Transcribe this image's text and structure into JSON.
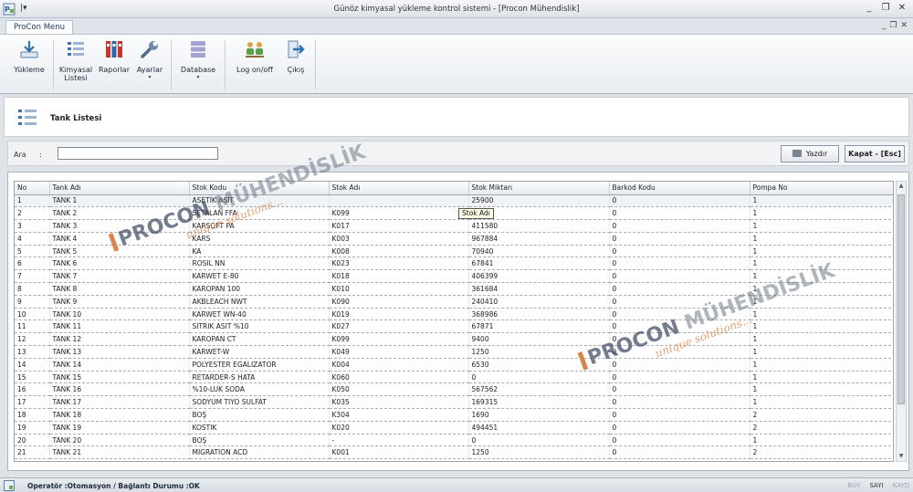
{
  "window": {
    "title": "Günöz kimyasal yükleme kontrol sistemi - [Procon Mühendislik]",
    "quick_access": "|▾",
    "controls": {
      "minimize": "_",
      "restore": "❐",
      "close": "✕"
    },
    "mdi_controls": {
      "minimize": "_",
      "restore": "❐",
      "close": "✕"
    }
  },
  "ribbon": {
    "tab": "ProCon Menu",
    "buttons": [
      {
        "label": "Yükleme",
        "icon": "download-icon"
      },
      {
        "label": "Kimyasal\nListesi",
        "icon": "list-icon"
      },
      {
        "label": "Raporlar",
        "icon": "reports-icon"
      },
      {
        "label": "Ayarlar",
        "icon": "wrench-icon",
        "dropdown": "▾"
      },
      {
        "label": "Database",
        "icon": "database-icon",
        "dropdown": "▾"
      },
      {
        "label": "Log on/off",
        "icon": "users-icon"
      },
      {
        "label": "Çıkış",
        "icon": "exit-icon"
      }
    ]
  },
  "panel": {
    "title": "Tank Listesi"
  },
  "search": {
    "label": "Ara",
    "colon": ":",
    "value": ""
  },
  "actions": {
    "print": "Yazdır",
    "close": "Kapat - [Esc]"
  },
  "grid": {
    "columns": [
      "No",
      "Tank Adı",
      "Stok Kodu",
      "Stok Adı",
      "Stok Miktarı",
      "Barkod Kodu",
      "Pompa No"
    ],
    "rows": [
      [
        "1",
        "TANK 1",
        "ASETİK ASİT",
        "",
        "25900",
        "0",
        "1"
      ],
      [
        "2",
        "TANK 2",
        "SETALAN FFA",
        "K099",
        "",
        "0",
        "1"
      ],
      [
        "3",
        "TANK 3",
        "KARSOFT PA",
        "K017",
        "411580",
        "0",
        "1"
      ],
      [
        "4",
        "TANK 4",
        "KARS",
        "K003",
        "967884",
        "0",
        "1"
      ],
      [
        "5",
        "TANK 5",
        "KA",
        "K008",
        "70940",
        "0",
        "1"
      ],
      [
        "6",
        "TANK 6",
        "ROSIL NN",
        "K023",
        "67841",
        "0",
        "1"
      ],
      [
        "7",
        "TANK 7",
        "KARWET E-80",
        "K018",
        "406399",
        "0",
        "1"
      ],
      [
        "8",
        "TANK 8",
        "KAROPAN 100",
        "K010",
        "361684",
        "0",
        "1"
      ],
      [
        "9",
        "TANK 9",
        "AKBLEACH NWT",
        "K090",
        "240410",
        "0",
        "1"
      ],
      [
        "10",
        "TANK 10",
        "KARWET WN-40",
        "K019",
        "368986",
        "0",
        "1"
      ],
      [
        "11",
        "TANK 11",
        "SITRIK ASIT %10",
        "K027",
        "67871",
        "0",
        "1"
      ],
      [
        "12",
        "TANK 12",
        "KAROPAN CT",
        "K099",
        "9400",
        "0",
        "1"
      ],
      [
        "13",
        "TANK 13",
        "KARWET-W",
        "K049",
        "1250",
        "0",
        "1"
      ],
      [
        "14",
        "TANK 14",
        "POLYESTER EGALIZATOR",
        "K004",
        "6530",
        "0",
        "1"
      ],
      [
        "15",
        "TANK 15",
        "RETARDER-S HATA",
        "K060",
        "0",
        "0",
        "1"
      ],
      [
        "16",
        "TANK 16",
        "%10-LUK SODA",
        "K050",
        "567562",
        "0",
        "1"
      ],
      [
        "17",
        "TANK 17",
        "SODYUM TIYO SULFAT",
        "K035",
        "169315",
        "0",
        "1"
      ],
      [
        "18",
        "TANK 18",
        "BOŞ",
        "K304",
        "1690",
        "0",
        "2"
      ],
      [
        "19",
        "TANK 19",
        "KOSTIK",
        "K020",
        "494451",
        "0",
        "2"
      ],
      [
        "20",
        "TANK 20",
        "BOŞ",
        "-",
        "0",
        "0",
        "1"
      ],
      [
        "21",
        "TANK 21",
        "MIGRATION ACD",
        "K001",
        "1250",
        "0",
        "2"
      ]
    ],
    "tooltip": "Stok Adı"
  },
  "watermark": {
    "brand_a": "PROCON",
    "brand_b": " MÜHENDİSLİK",
    "slogan": "unique solutions..."
  },
  "status": {
    "text": "Operatör :Otomasyon / Bağlantı Durumu :OK",
    "keys": [
      "BÜY",
      "SAYI",
      "KAYD"
    ]
  }
}
